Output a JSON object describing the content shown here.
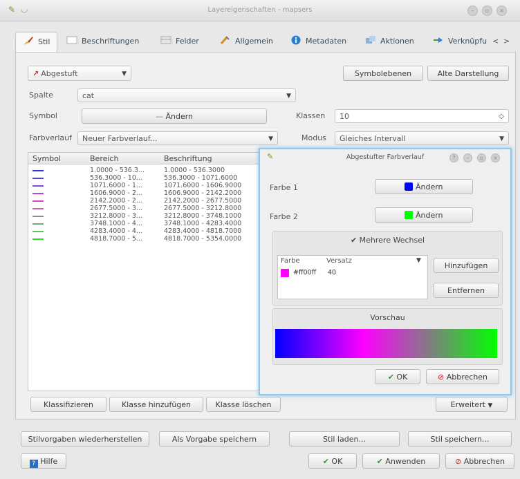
{
  "window": {
    "title": "Layereigenschaften - mapsers"
  },
  "tabs": [
    "Stil",
    "Beschriftungen",
    "Felder",
    "Allgemein",
    "Metadaten",
    "Aktionen",
    "Verknüpfu"
  ],
  "tab_nav": {
    "prev": "<",
    "next": ">"
  },
  "renderer": {
    "value": "Abgestuft"
  },
  "buttons": {
    "symbol_levels": "Symbolebenen",
    "old_rendering": "Alte Darstellung",
    "change_symbol": "Ändern"
  },
  "fields": {
    "column_label": "Spalte",
    "column_value": "cat",
    "symbol_label": "Symbol",
    "classes_label": "Klassen",
    "classes_value": "10",
    "ramp_label": "Farbverlauf",
    "ramp_value": "Neuer Farbverlauf...",
    "mode_label": "Modus",
    "mode_value": "Gleiches Intervall"
  },
  "table": {
    "headers": [
      "Symbol",
      "Bereich",
      "Beschriftung"
    ],
    "rows": [
      {
        "color": "#3333dd",
        "range": "1.0000 - 536.3...",
        "label": "1.0000 - 536.3000"
      },
      {
        "color": "#5544dd",
        "range": "536.3000 - 10...",
        "label": "536.3000 - 1071.6000"
      },
      {
        "color": "#8844dd",
        "range": "1071.6000 - 1...",
        "label": "1071.6000 - 1606.9000"
      },
      {
        "color": "#bb44dd",
        "range": "1606.9000 - 2...",
        "label": "1606.9000 - 2142.2000"
      },
      {
        "color": "#dd44cc",
        "range": "2142.2000 - 2...",
        "label": "2142.2000 - 2677.5000"
      },
      {
        "color": "#cc66bb",
        "range": "2677.5000 - 3...",
        "label": "2677.5000 - 3212.8000"
      },
      {
        "color": "#998899",
        "range": "3212.8000 - 3...",
        "label": "3212.8000 - 3748.1000"
      },
      {
        "color": "#77aa77",
        "range": "3748.1000 - 4...",
        "label": "3748.1000 - 4283.4000"
      },
      {
        "color": "#55cc55",
        "range": "4283.4000 - 4...",
        "label": "4283.4000 - 4818.7000"
      },
      {
        "color": "#33dd33",
        "range": "4818.7000 - 5...",
        "label": "4818.7000 - 5354.0000"
      }
    ]
  },
  "class_buttons": {
    "classify": "Klassifizieren",
    "add_class": "Klasse hinzufügen",
    "delete_class": "Klasse löschen",
    "advanced": "Erweitert"
  },
  "style_buttons": {
    "restore": "Stilvorgaben wiederherstellen",
    "save_default": "Als Vorgabe speichern",
    "load": "Stil laden...",
    "save": "Stil speichern..."
  },
  "bottom": {
    "help": "Hilfe",
    "ok": "OK",
    "apply": "Anwenden",
    "cancel": "Abbrechen"
  },
  "dialog": {
    "title": "Abgestufter Farbverlauf",
    "color1_label": "Farbe 1",
    "color1": "#0000ff",
    "color2_label": "Farbe 2",
    "color2": "#00ff00",
    "change": "Ändern",
    "multi_stops": "Mehrere Wechsel",
    "col_color": "Farbe",
    "col_offset": "Versatz",
    "stop_color": "#ff00ff",
    "stop_name": "#ff00ff",
    "stop_offset": "40",
    "add": "Hinzufügen",
    "remove": "Entfernen",
    "preview": "Vorschau",
    "ok": "OK",
    "cancel": "Abbrechen"
  }
}
